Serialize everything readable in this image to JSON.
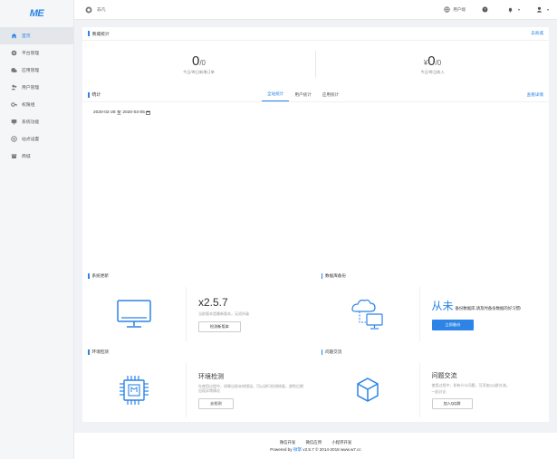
{
  "app": {
    "logo": "ME"
  },
  "sidebar": {
    "items": [
      {
        "label": "首页",
        "icon": "home-icon",
        "active": true
      },
      {
        "label": "平台管理",
        "icon": "platform-icon"
      },
      {
        "label": "应用管理",
        "icon": "apps-icon"
      },
      {
        "label": "用户管理",
        "icon": "users-icon"
      },
      {
        "label": "权限组",
        "icon": "permission-icon"
      },
      {
        "label": "系统功能",
        "icon": "system-icon"
      },
      {
        "label": "站点设置",
        "icon": "settings-icon"
      },
      {
        "label": "商城",
        "icon": "store-icon"
      }
    ]
  },
  "topbar": {
    "site_label": "非凡",
    "user_center": "用户端",
    "help_icon": "question-icon",
    "bell_icon": "bell-icon",
    "user_icon": "user-icon"
  },
  "mall_stats": {
    "title": "商城统计",
    "link": "去商城",
    "orders": {
      "value": "0",
      "sub": "/0",
      "label": "今日/昨日新增订单"
    },
    "income": {
      "prefix": "¥",
      "value": "0",
      "sub": "/0",
      "label": "今日/昨日收入"
    }
  },
  "stats": {
    "title": "统计",
    "tabs": [
      "全站统计",
      "用户统计",
      "应用统计"
    ],
    "active_tab": 0,
    "link": "查看详情",
    "date_start": "2020-02-28",
    "date_sep": "至",
    "date_end": "2020-03-05"
  },
  "cards": {
    "update": {
      "title": "系统更新",
      "version": "x2.5.7",
      "desc": "当前版本是最新版本，无须升级",
      "button": "检测新版本"
    },
    "backup": {
      "title": "数据库备份",
      "big": "从未",
      "small": "备份数据库,请及时备份数据的好习惯!",
      "button": "立即备份"
    },
    "env": {
      "title": "环境检测",
      "heading": "环境检测",
      "desc": "在使用过程中，如果出现未知错误，可以进行检测修复，避免后期出现异常情况",
      "button": "去检测"
    },
    "qa": {
      "title": "问题交流",
      "heading": "问题交流",
      "desc": "使用过程中，如有什么问题，可添加QQ群交流。",
      "desc2": "一起讨论",
      "button": "加入QQ群"
    }
  },
  "footer": {
    "links": [
      "微信开发",
      "微信应用",
      "小程序开发"
    ],
    "powered_prefix": "Powered by ",
    "brand": "微擎",
    "powered_suffix": " v2.5.7 © 2014-2018 www.w7.cc"
  },
  "colors": {
    "accent": "#2b84e6",
    "sidebar_bg": "#f5f6f8",
    "page_bg": "#f0f2f5"
  }
}
